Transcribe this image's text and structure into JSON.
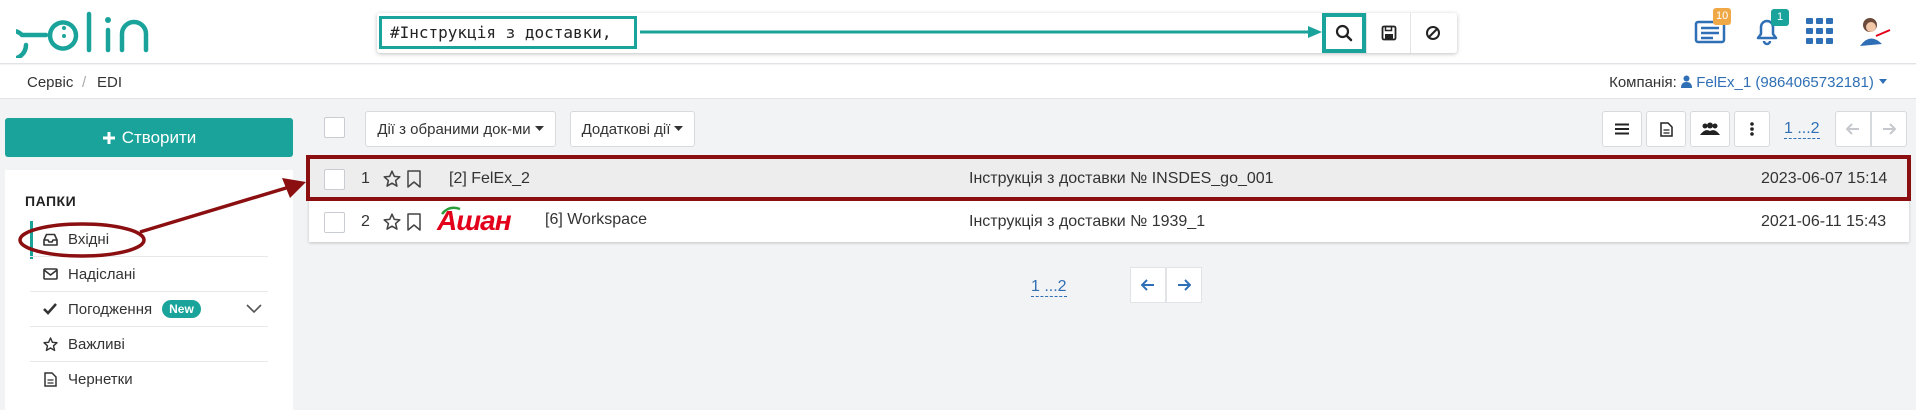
{
  "header": {
    "logo_text": "edin",
    "search": {
      "value": "#Інструкція з доставки,"
    },
    "icons": [
      "search-icon",
      "save-icon",
      "ban-icon",
      "documents-icon",
      "bell-icon",
      "apps-grid-icon",
      "avatar"
    ],
    "badges": {
      "documents": "10",
      "notifications": "1"
    }
  },
  "breadcrumb": {
    "items": [
      "Сервіс",
      "EDI"
    ],
    "separator": "/"
  },
  "company": {
    "label": "Компанія:",
    "value": "FelEx_1 (9864065732181)"
  },
  "sidebar": {
    "create_label": "Створити",
    "folders_title": "ПАПКИ",
    "items": [
      {
        "label": "Вхідні",
        "icon": "inbox-icon",
        "active": true
      },
      {
        "label": "Надіслані",
        "icon": "envelope-icon"
      },
      {
        "label": "Погодження",
        "icon": "check-icon",
        "badge": "New"
      },
      {
        "label": "Важливі",
        "icon": "star-icon"
      },
      {
        "label": "Чернетки",
        "icon": "draft-icon"
      }
    ]
  },
  "toolbar": {
    "bulk_actions": "Дії з обраними док-ми",
    "extra_actions": "Додаткові дії",
    "pager": "1 ...2"
  },
  "documents": [
    {
      "num": "1",
      "partner": "[2] FelEx_2",
      "title": "Інструкція з доставки № INSDES_go_001",
      "date": "2023-06-07 15:14",
      "logo": ""
    },
    {
      "num": "2",
      "partner": "[6] Workspace",
      "title": "Інструкція з доставки № 1939_1",
      "date": "2021-06-11 15:43",
      "logo": "Ашан"
    }
  ],
  "pager_bottom": "1 ...2",
  "colors": {
    "accent": "#1aa39a",
    "link": "#2f6fb5",
    "annotation": "#8b0e10",
    "brand_red": "#e2001a"
  }
}
